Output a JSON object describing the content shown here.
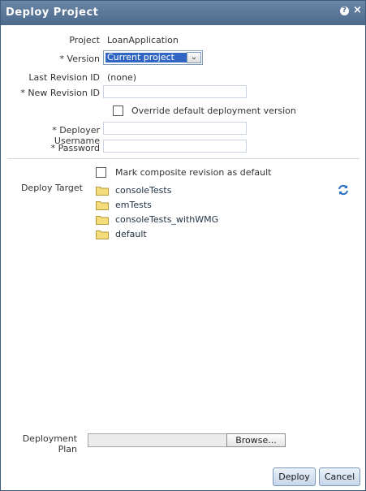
{
  "dialog": {
    "title": "Deploy Project",
    "help_icon_glyph": "?",
    "close_icon_glyph": "×"
  },
  "fields": {
    "project_label": "Project",
    "project_value": "LoanApplication",
    "version_label": "Version",
    "version_selected": "Current project",
    "last_revision_label": "Last Revision ID",
    "last_revision_value": "(none)",
    "new_revision_label": "New Revision ID",
    "new_revision_value": "",
    "override_label": "Override default deployment version",
    "deployer_username_label": "Deployer Username",
    "deployer_username_value": "",
    "password_label": "Password",
    "password_value": "",
    "required_mark": "*"
  },
  "target": {
    "mark_default_label": "Mark composite revision as default",
    "deploy_target_label": "Deploy Target",
    "folders": [
      "consoleTests",
      "emTests",
      "consoleTests_withWMG",
      "default"
    ]
  },
  "plan": {
    "label_line1": "Deployment",
    "label_line2": "Plan",
    "browse_label": "Browse..."
  },
  "buttons": {
    "deploy_label": "Deploy",
    "cancel_label": "Cancel"
  },
  "icons": {
    "folder": "folder-icon",
    "refresh": "refresh-icon",
    "help": "help-icon",
    "close": "close-icon"
  },
  "colors": {
    "titlebar": "#5b7899",
    "selection": "#3166c3",
    "folder": "#f4dc7a"
  }
}
